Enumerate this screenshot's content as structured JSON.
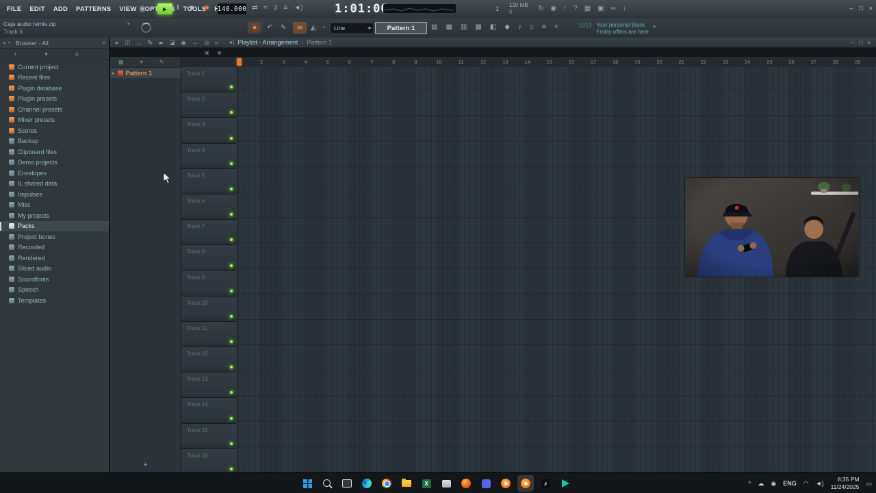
{
  "colors": {
    "accent_orange": "#e08136",
    "play_green": "#86e04a",
    "led_green": "#a7f051",
    "browser_text": "#8fb0ba",
    "taskbar_bg": "#141719"
  },
  "menubar": {
    "items": [
      "FILE",
      "EDIT",
      "ADD",
      "PATTERNS",
      "VIEW",
      "OPTIONS",
      "TOOLS",
      "HELP"
    ]
  },
  "transport": {
    "disc_glyph": "◉",
    "play_glyph": "▶",
    "pause_glyph": "‖",
    "stop_glyph": "■",
    "record_glyph": "●",
    "tempo": "140.000",
    "time": "1:01:00",
    "bar_indicator": "1",
    "memory": "120 MB",
    "cpu_value": "0"
  },
  "titlebar_small_icons": [
    {
      "name": "pattern-song-switch-icon",
      "glyph": "⇄"
    },
    {
      "name": "wave-icon",
      "glyph": "≈"
    },
    {
      "name": "countdown-icon",
      "glyph": "3"
    },
    {
      "name": "steps-icon",
      "glyph": "≡"
    },
    {
      "name": "master-volume-icon",
      "glyph": "◄)"
    }
  ],
  "titlebar_icons": [
    {
      "name": "sync-icon",
      "glyph": "↻"
    },
    {
      "name": "recording-status-icon",
      "glyph": "◉"
    },
    {
      "name": "update-icon",
      "glyph": "↑"
    },
    {
      "name": "help-icon",
      "glyph": "?"
    },
    {
      "name": "typing-keyboard-icon",
      "glyph": "▦"
    },
    {
      "name": "monitor-icon",
      "glyph": "▣"
    },
    {
      "name": "link-controllers-icon",
      "glyph": "∞"
    },
    {
      "name": "download-icon",
      "glyph": "↓"
    }
  ],
  "window_controls": {
    "minimize": "–",
    "maximize": "□",
    "close": "×"
  },
  "file_info": {
    "filename": "Caja audio remix.zip",
    "track_label": "Track 6",
    "dropdown_glyph": "▾"
  },
  "toolbar": {
    "record_glyph": "●",
    "undo_glyph": "↶",
    "edit_glyph": "✎",
    "link_glyph": "∞",
    "metronome_glyph": "◭",
    "wait_glyph": "◔",
    "snap_label": "Line",
    "snap_arrow": "▾",
    "next_glyph": "▸",
    "pattern_selector": "Pattern 1",
    "right_icons": [
      {
        "name": "playlist-icon",
        "glyph": "▤"
      },
      {
        "name": "piano-roll-icon",
        "glyph": "▦"
      },
      {
        "name": "channel-rack-icon",
        "glyph": "▥"
      },
      {
        "name": "mixer-icon",
        "glyph": "▩"
      },
      {
        "name": "browser-toggle-icon",
        "glyph": "◧"
      },
      {
        "name": "plugin-icon",
        "glyph": "◆"
      },
      {
        "name": "tempo-tap-icon",
        "glyph": "♪"
      },
      {
        "name": "touch-icon",
        "glyph": "⌂"
      },
      {
        "name": "tools-menu-icon",
        "glyph": "≡"
      },
      {
        "name": "close-all-icon",
        "glyph": "×"
      }
    ],
    "notification": {
      "badge": "11/13",
      "line1": "Your personal Black",
      "line2": "Friday offers are here",
      "arrow": "▸"
    }
  },
  "browser": {
    "arrow_up": "▴",
    "arrow_down": "▾",
    "title": "Browser - All",
    "header_icon": "≡",
    "sub_icons": [
      {
        "name": "browser-up-icon",
        "glyph": "+"
      },
      {
        "name": "browser-collapse-icon",
        "glyph": "▾"
      },
      {
        "name": "browser-options-icon",
        "glyph": "≡"
      }
    ],
    "items": [
      {
        "label": "Current project",
        "class": "special",
        "name": "browser-item-current-project"
      },
      {
        "label": "Recent files",
        "class": "special",
        "name": "browser-item-recent-files"
      },
      {
        "label": "Plugin database",
        "class": "special",
        "name": "browser-item-plugin-database"
      },
      {
        "label": "Plugin presets",
        "class": "special",
        "name": "browser-item-plugin-presets"
      },
      {
        "label": "Channel presets",
        "class": "special",
        "name": "browser-item-channel-presets"
      },
      {
        "label": "Mixer presets",
        "class": "special",
        "name": "browser-item-mixer-presets"
      },
      {
        "label": "Scores",
        "class": "special",
        "name": "browser-item-scores"
      },
      {
        "label": "Backup",
        "class": "folder",
        "name": "browser-item-backup"
      },
      {
        "label": "Clipboard files",
        "class": "folder",
        "name": "browser-item-clipboard-files"
      },
      {
        "label": "Demo projects",
        "class": "folder",
        "name": "browser-item-demo-projects"
      },
      {
        "label": "Envelopes",
        "class": "folder",
        "name": "browser-item-envelopes"
      },
      {
        "label": "IL shared data",
        "class": "folder",
        "name": "browser-item-il-shared-data"
      },
      {
        "label": "Impulses",
        "class": "folder",
        "name": "browser-item-impulses"
      },
      {
        "label": "Misc",
        "class": "folder",
        "name": "browser-item-misc"
      },
      {
        "label": "My projects",
        "class": "folder",
        "name": "browser-item-my-projects"
      },
      {
        "label": "Packs",
        "class": "folder selected",
        "name": "browser-item-packs"
      },
      {
        "label": "Project bones",
        "class": "folder",
        "name": "browser-item-project-bones"
      },
      {
        "label": "Recorded",
        "class": "folder",
        "name": "browser-item-recorded"
      },
      {
        "label": "Rendered",
        "class": "folder",
        "name": "browser-item-rendered"
      },
      {
        "label": "Sliced audio",
        "class": "folder",
        "name": "browser-item-sliced-audio"
      },
      {
        "label": "Soundfonts",
        "class": "folder",
        "name": "browser-item-soundfonts"
      },
      {
        "label": "Speech",
        "class": "folder",
        "name": "browser-item-speech"
      },
      {
        "label": "Templates",
        "class": "folder",
        "name": "browser-item-templates"
      }
    ]
  },
  "pattern_panel": {
    "header_icons": [
      {
        "name": "pattern-grid-icon",
        "glyph": "▦"
      },
      {
        "name": "pattern-filter-icon",
        "glyph": "▾"
      },
      {
        "name": "pattern-rename-icon",
        "glyph": "✎"
      }
    ],
    "play_marker": "▸",
    "items": [
      {
        "label": "Pattern 1",
        "name": "pattern-list-item-pattern-1"
      }
    ],
    "add_label": "+"
  },
  "playlist": {
    "tool_icons": [
      {
        "name": "pointer-tool-icon",
        "glyph": "▸"
      },
      {
        "name": "detach-icon",
        "glyph": "◫"
      },
      {
        "name": "magnet-snap-icon",
        "glyph": "◡"
      },
      {
        "name": "draw-tool-icon",
        "glyph": "✎",
        "class": "sel"
      },
      {
        "name": "paint-tool-icon",
        "glyph": "▰"
      },
      {
        "name": "delete-tool-icon",
        "glyph": "◪"
      },
      {
        "name": "mute-tool-icon",
        "glyph": "◉"
      },
      {
        "name": "slip-tool-icon",
        "glyph": "↔"
      },
      {
        "name": "zoom-tool-icon",
        "glyph": "◎"
      },
      {
        "name": "playback-tool-icon",
        "glyph": "▹"
      }
    ],
    "speaker_glyph": "◄)",
    "title": "Playlist - Arrangement",
    "separator": "›",
    "subtitle": "Pattern 1",
    "strip_icons": [
      {
        "name": "video-marker-icon",
        "glyph": "▣"
      },
      {
        "name": "loop-record-icon",
        "glyph": "◉"
      }
    ],
    "timeline": [
      "2",
      "3",
      "4",
      "5",
      "6",
      "7",
      "8",
      "9",
      "10",
      "11",
      "12",
      "13",
      "14",
      "15",
      "16",
      "17",
      "18",
      "19",
      "20",
      "21",
      "22",
      "23",
      "24",
      "25",
      "26",
      "27",
      "28",
      "29"
    ],
    "tracks": [
      "Track 1",
      "Track 2",
      "Track 3",
      "Track 4",
      "Track 5",
      "Track 6",
      "Track 7",
      "Track 8",
      "Track 9",
      "Track 10",
      "Track 11",
      "Track 12",
      "Track 13",
      "Track 14",
      "Track 15",
      "Track 16"
    ]
  },
  "taskbar": {
    "icons": [
      {
        "name": "start-button",
        "class": "tb-win",
        "glyph": ""
      },
      {
        "name": "search-icon",
        "class": "tb-search",
        "glyph": ""
      },
      {
        "name": "task-view-icon",
        "class": "tb-taskview",
        "glyph": ""
      },
      {
        "name": "edge-browser-icon",
        "class": "tb-edge",
        "glyph": ""
      },
      {
        "name": "chrome-browser-icon",
        "class": "tb-chrome",
        "glyph": ""
      },
      {
        "name": "file-explorer-icon",
        "class": "tb-folder",
        "glyph": ""
      },
      {
        "name": "excel-icon",
        "class": "tb-excel",
        "glyph": "X"
      },
      {
        "name": "app-window-icon",
        "class": "tb-gray",
        "glyph": ""
      },
      {
        "name": "firefox-browser-icon",
        "class": "tb-orange",
        "glyph": ""
      },
      {
        "name": "purple-app-icon",
        "class": "tb-purple",
        "glyph": ""
      },
      {
        "name": "fl-studio-icon",
        "class": "tb-fl",
        "glyph": ""
      },
      {
        "name": "fl-studio-running-icon",
        "class": "tb-fl active",
        "glyph": ""
      },
      {
        "name": "tiktok-icon",
        "class": "tb-tiktok",
        "glyph": "♪"
      },
      {
        "name": "media-play-icon",
        "class": "tb-play",
        "glyph": ""
      }
    ],
    "tray": [
      {
        "name": "hidden-icons-chevron",
        "glyph": "^"
      },
      {
        "name": "onedrive-icon",
        "glyph": "☁"
      },
      {
        "name": "microphone-icon",
        "glyph": "◉"
      },
      {
        "name": "language-indicator",
        "glyph": "ENG",
        "class": "txt"
      },
      {
        "name": "network-icon",
        "glyph": "◠"
      },
      {
        "name": "volume-tray-icon",
        "glyph": "◄)"
      }
    ],
    "clock": {
      "time": "8:35 PM",
      "date": "11/24/2025"
    },
    "notification_glyph": "▭"
  }
}
